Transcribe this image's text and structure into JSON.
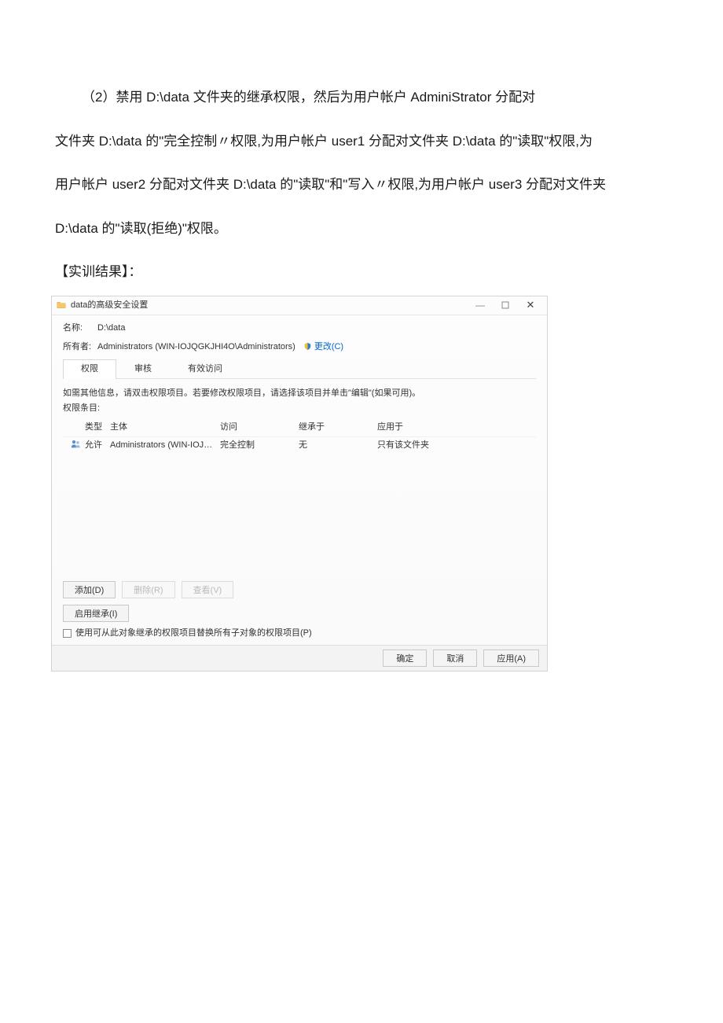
{
  "doc": {
    "p1": "（2）禁用 D:\\data 文件夹的继承权限，然后为用户帐户 AdminiStrator 分配对",
    "p2": "文件夹 D:\\data 的\"完全控制〃权限,为用户帐户 user1 分配对文件夹 D:\\data 的\"读取\"权限,为",
    "p3": "用户帐户 user2 分配对文件夹 D:\\data 的\"读取\"和\"写入〃权限,为用户帐户 user3 分配对文件夹",
    "p4": "D:\\data 的\"读取(拒绝)\"权限。",
    "result_title": "【实训结果】："
  },
  "dialog": {
    "title": "data的高级安全设置",
    "name_label": "名称:",
    "name_value": "D:\\data",
    "owner_label": "所有者:",
    "owner_value": "Administrators (WIN-IOJQGKJHI4O\\Administrators)",
    "change_link": "更改(C)",
    "tabs": {
      "perm": "权限",
      "audit": "审核",
      "effective": "有效访问"
    },
    "hint": "如需其他信息，请双击权限项目。若要修改权限项目，请选择该项目并单击\"编辑\"(如果可用)。",
    "entries_label": "权限条目:",
    "columns": {
      "type": "类型",
      "principal": "主体",
      "access": "访问",
      "inherited": "继承于",
      "applies": "应用于"
    },
    "row1": {
      "type": "允许",
      "principal": "Administrators (WIN-IOJQGKJHI...",
      "access": "完全控制",
      "inherited": "无",
      "applies": "只有该文件夹"
    },
    "buttons": {
      "add": "添加(D)",
      "remove": "删除(R)",
      "view": "查看(V)",
      "enable_inherit": "启用继承(I)",
      "replace_checkbox": "使用可从此对象继承的权限项目替换所有子对象的权限项目(P)",
      "ok": "确定",
      "cancel": "取消",
      "apply": "应用(A)"
    }
  }
}
